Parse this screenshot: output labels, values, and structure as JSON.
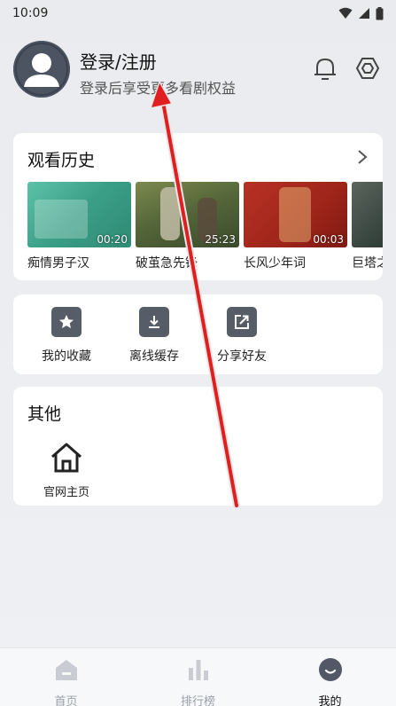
{
  "status": {
    "time": "10:09"
  },
  "profile": {
    "title": "登录/注册",
    "subtitle": "登录后享受更多看剧权益"
  },
  "history": {
    "title": "观看历史",
    "items": [
      {
        "label": "痴情男子汉",
        "time": "00:20",
        "color": "#3fa98f"
      },
      {
        "label": "破茧急先锋",
        "time": "25:23",
        "color": "#5d6f3a"
      },
      {
        "label": "长风少年词",
        "time": "00:03",
        "color": "#a9291e"
      },
      {
        "label": "巨塔之",
        "time": "",
        "color": "#3e4a44"
      }
    ]
  },
  "actions": [
    {
      "label": "我的收藏",
      "icon": "star-icon"
    },
    {
      "label": "离线缓存",
      "icon": "download-icon"
    },
    {
      "label": "分享好友",
      "icon": "share-icon"
    }
  ],
  "other": {
    "title": "其他",
    "site_label": "官网主页"
  },
  "nav": [
    {
      "label": "首页",
      "icon": "home-icon",
      "active": false
    },
    {
      "label": "排行榜",
      "icon": "ranking-icon",
      "active": false
    },
    {
      "label": "我的",
      "icon": "profile-icon",
      "active": true
    }
  ]
}
